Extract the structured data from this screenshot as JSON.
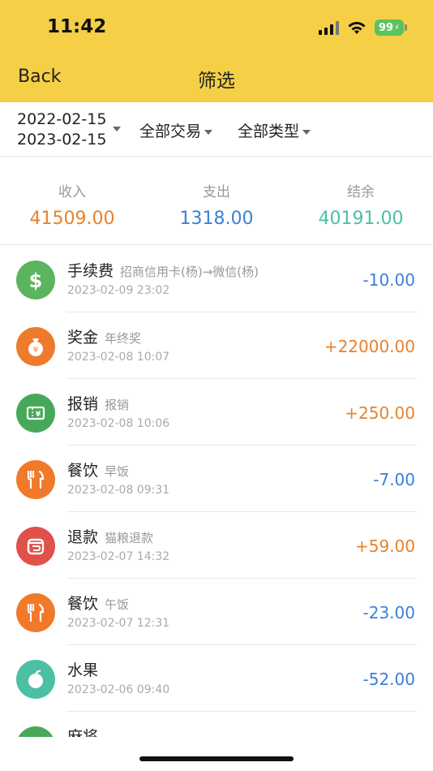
{
  "status": {
    "time": "11:42",
    "battery": "99"
  },
  "nav": {
    "back_label": "Back",
    "title": "筛选"
  },
  "filters": {
    "start_date": "2022-02-15",
    "end_date": "2023-02-15",
    "transaction_filter": "全部交易",
    "type_filter": "全部类型"
  },
  "summary": {
    "income_label": "收入",
    "income_value": "41509.00",
    "expense_label": "支出",
    "expense_value": "1318.00",
    "balance_label": "结余",
    "balance_value": "40191.00"
  },
  "colors": {
    "header": "#f5cf45",
    "income": "#e8822a",
    "expense": "#3d7fd9",
    "balance": "#4dbfa3"
  },
  "transactions": [
    {
      "category": "手续费",
      "note": "招商信用卡(杨)→微信(杨)",
      "time": "2023-02-09 23:02",
      "amount": "-10.00",
      "icon": "dollar-icon",
      "icon_color": "#5ab55e",
      "amount_color": "#3d7fd9"
    },
    {
      "category": "奖金",
      "note": "年终奖",
      "time": "2023-02-08 10:07",
      "amount": "+22000.00",
      "icon": "money-bag-icon",
      "icon_color": "#ee7a2b",
      "amount_color": "#e8822a"
    },
    {
      "category": "报销",
      "note": "报销",
      "time": "2023-02-08 10:06",
      "amount": "+250.00",
      "icon": "receipt-icon",
      "icon_color": "#46a95a",
      "amount_color": "#e8822a"
    },
    {
      "category": "餐饮",
      "note": "早饭",
      "time": "2023-02-08 09:31",
      "amount": "-7.00",
      "icon": "utensils-icon",
      "icon_color": "#f07a2a",
      "amount_color": "#3d7fd9"
    },
    {
      "category": "退款",
      "note": "猫粮退款",
      "time": "2023-02-07 14:32",
      "amount": "+59.00",
      "icon": "refund-icon",
      "icon_color": "#e0514a",
      "amount_color": "#e8822a"
    },
    {
      "category": "餐饮",
      "note": "午饭",
      "time": "2023-02-07 12:31",
      "amount": "-23.00",
      "icon": "utensils-icon",
      "icon_color": "#f07a2a",
      "amount_color": "#3d7fd9"
    },
    {
      "category": "水果",
      "note": "",
      "time": "2023-02-06 09:40",
      "amount": "-52.00",
      "icon": "fruit-icon",
      "icon_color": "#4dbfa3",
      "amount_color": "#3d7fd9"
    },
    {
      "category": "麻将",
      "note": "",
      "time": "",
      "amount": "",
      "icon": "mahjong-icon",
      "icon_color": "#46a95a",
      "amount_color": "#3d7fd9"
    }
  ]
}
